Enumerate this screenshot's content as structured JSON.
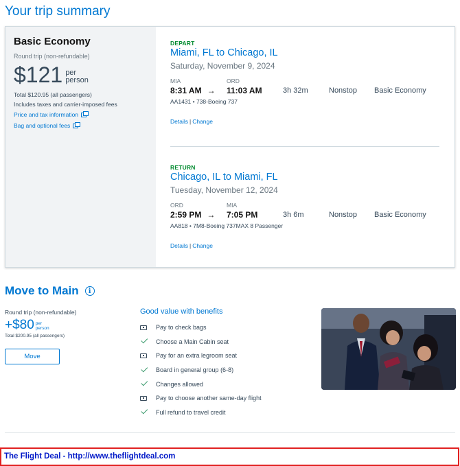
{
  "page_title": "Your trip summary",
  "fare": {
    "title": "Basic Economy",
    "subtitle": "Round trip (non-refundable)",
    "price": "$121",
    "per_person_1": "per",
    "per_person_2": "person",
    "total": "Total $120.95 (all passengers)",
    "fees_note": "Includes taxes and carrier-imposed fees",
    "price_tax_link": "Price and tax information",
    "bag_link": "Bag and optional fees"
  },
  "segments": [
    {
      "tag": "DEPART",
      "route": "Miami, FL to Chicago, IL",
      "date": "Saturday, November 9, 2024",
      "origin": "MIA",
      "destination": "ORD",
      "depart_time": "8:31 AM",
      "arrive_time": "11:03 AM",
      "duration": "3h 32m",
      "stops": "Nonstop",
      "cabin": "Basic Economy",
      "flight": "AA1431 • 738-Boeing 737",
      "details_link": "Details",
      "change_link": "Change"
    },
    {
      "tag": "RETURN",
      "route": "Chicago, IL to Miami, FL",
      "date": "Tuesday, November 12, 2024",
      "origin": "ORD",
      "destination": "MIA",
      "depart_time": "2:59 PM",
      "arrive_time": "7:05 PM",
      "duration": "3h 6m",
      "stops": "Nonstop",
      "cabin": "Basic Economy",
      "flight": "AA818 • 7M8-Boeing 737MAX 8 Passenger",
      "details_link": "Details",
      "change_link": "Change"
    }
  ],
  "upsell": {
    "title": "Move to Main",
    "subtitle": "Round trip (non-refundable)",
    "price": "+$80",
    "per_1": "per",
    "per_2": "person",
    "total": "Total $200.95 (all passengers)",
    "button_label": "Move",
    "benefits_title": "Good value with benefits",
    "benefits": [
      {
        "text": "Pay to check bags",
        "icon": "bag-icon"
      },
      {
        "text": "Choose a Main Cabin seat",
        "icon": "check-icon"
      },
      {
        "text": "Pay for an extra legroom seat",
        "icon": "bag-icon"
      },
      {
        "text": "Board in general group (6-8)",
        "icon": "check-icon"
      },
      {
        "text": "Changes allowed",
        "icon": "check-icon"
      },
      {
        "text": "Pay to choose another same-day flight",
        "icon": "bag-icon"
      },
      {
        "text": "Full refund to travel credit",
        "icon": "check-icon"
      }
    ]
  },
  "banner": "The Flight Deal - http://www.theflightdeal.com",
  "colors": {
    "accent": "#0078d2",
    "tag_green": "#008a2e",
    "check_green": "#3a9a6c",
    "banner_border": "#e12020",
    "banner_text": "#0018c8"
  }
}
